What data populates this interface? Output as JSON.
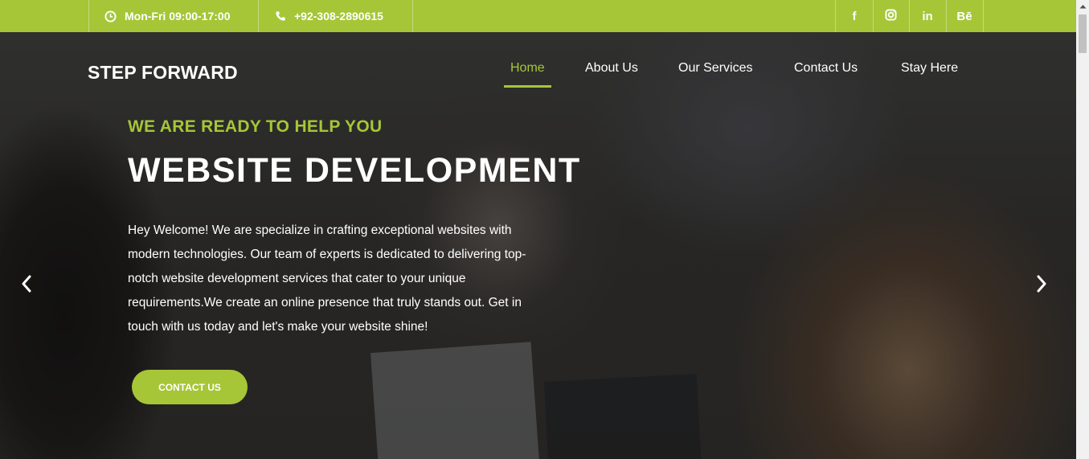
{
  "topbar": {
    "hours": "Mon-Fri 09:00-17:00",
    "phone": "+92-308-2890615",
    "social": {
      "facebook": "f",
      "linkedin": "in",
      "behance": "Bē"
    }
  },
  "header": {
    "brand": "STEP FORWARD",
    "nav": [
      {
        "label": "Home",
        "active": true
      },
      {
        "label": "About Us"
      },
      {
        "label": "Our Services"
      },
      {
        "label": "Contact Us"
      },
      {
        "label": "Stay Here"
      }
    ]
  },
  "hero": {
    "kicker": "WE ARE READY TO HELP YOU",
    "headline": "WEBSITE DEVELOPMENT",
    "description_lines": [
      "Hey Welcome! We are specialize in crafting exceptional websites with",
      "modern technologies. Our team of experts is dedicated to delivering top-",
      "notch website development services that cater to your unique",
      "requirements.We create an online presence that truly stands out. Get in",
      "touch with us today and let's make your website shine!"
    ],
    "cta_label": "CONTACT US"
  },
  "colors": {
    "accent": "#a6c637",
    "text_light": "#ffffff"
  },
  "icons": {
    "hours": "clock-icon",
    "phone": "phone-icon",
    "prev": "chevron-left-icon",
    "next": "chevron-right-icon"
  }
}
